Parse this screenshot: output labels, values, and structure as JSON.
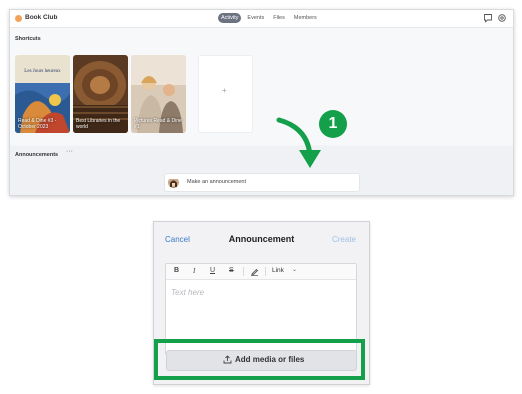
{
  "app": {
    "group_name": "Book Club",
    "tabs": [
      {
        "label": "Activity",
        "active": true
      },
      {
        "label": "Events",
        "active": false
      },
      {
        "label": "Files",
        "active": false
      },
      {
        "label": "Members",
        "active": false
      }
    ],
    "icons": [
      "chat-icon",
      "settings-icon"
    ]
  },
  "shortcuts": {
    "title": "Shortcuts",
    "cards": [
      {
        "caption": "Read & Dine #3 - October 2023",
        "cover_text": "Les Jours heureux"
      },
      {
        "caption": "Best Libraries in the world"
      },
      {
        "caption": "Pictures Read & Dine #1"
      }
    ],
    "add_label": "+"
  },
  "announcements": {
    "title": "Announcements",
    "more_label": "···",
    "placeholder": "Make an announcement"
  },
  "callout": {
    "step_number": "1",
    "accent_color": "#14a04a"
  },
  "composer": {
    "cancel_label": "Cancel",
    "title": "Announcement",
    "create_label": "Create",
    "toolbar": {
      "bold": "B",
      "italic": "I",
      "underline": "U",
      "strike": "S",
      "link_label": "Link"
    },
    "text_placeholder": "Text here",
    "add_media_label": "Add media or files"
  }
}
